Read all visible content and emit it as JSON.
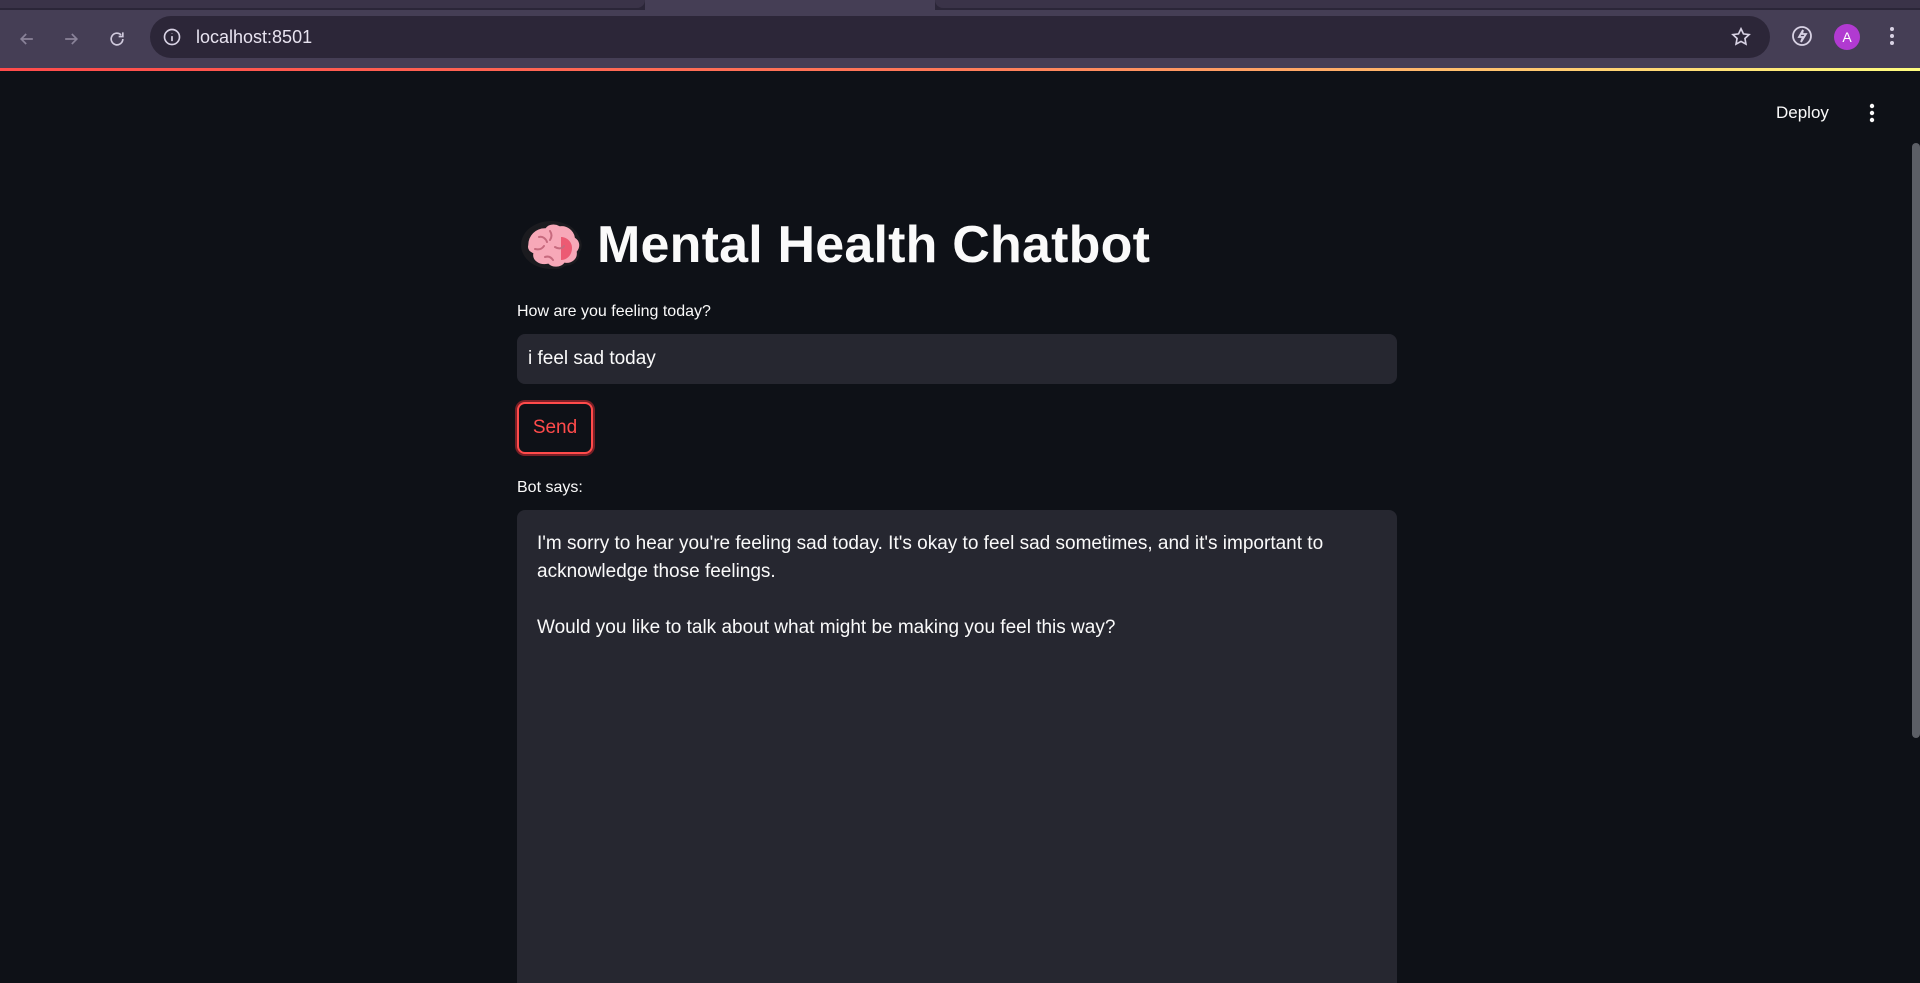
{
  "browser": {
    "url": "localhost:8501",
    "profile_initial": "A"
  },
  "app_header": {
    "deploy_label": "Deploy"
  },
  "main": {
    "title": "Mental Health Chatbot",
    "title_icon": "brain-emoji",
    "input_label": "How are you feeling today?",
    "input_value": "i feel sad today",
    "send_label": "Send",
    "bot_label": "Bot says:",
    "bot_response": {
      "paragraph_1": "I'm sorry to hear you're feeling sad today. It's okay to feel sad sometimes, and it's important to acknowledge those feelings.",
      "paragraph_2": "Would you like to talk about what might be making you feel this way?"
    }
  },
  "colors": {
    "background": "#0e1117",
    "accent": "#ff4b4b",
    "input_bg": "#262730",
    "browser_toolbar": "#453e55"
  }
}
